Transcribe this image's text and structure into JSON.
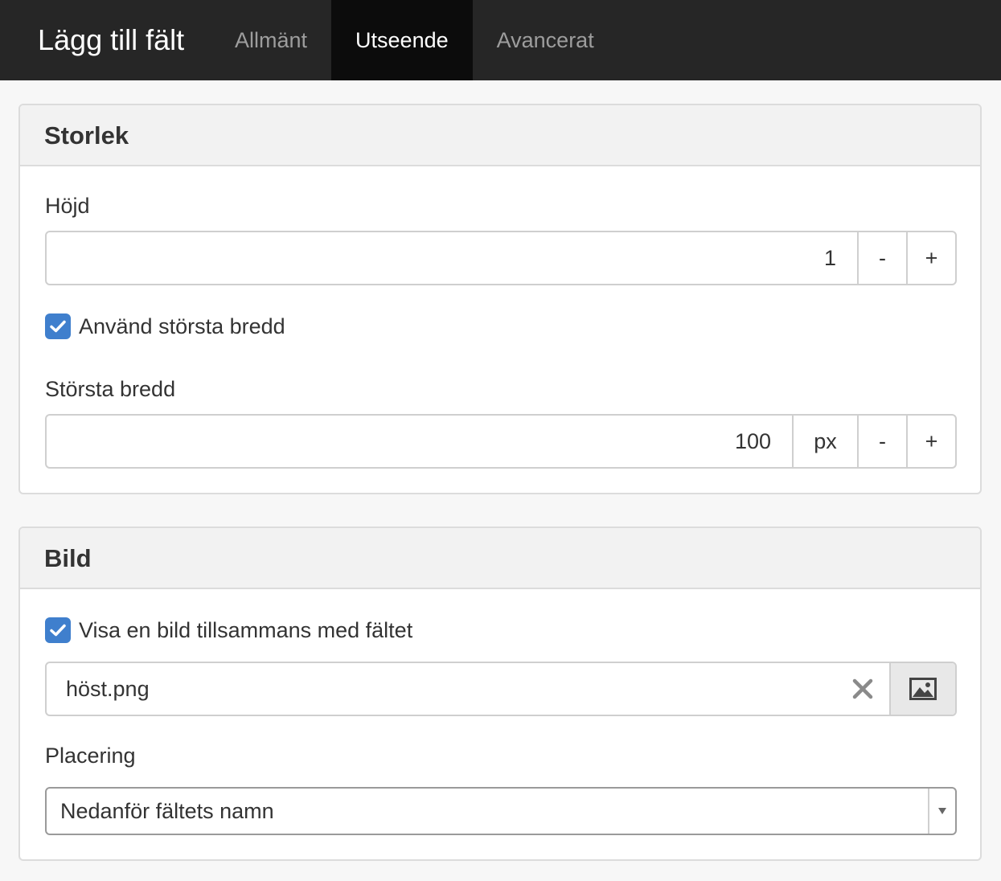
{
  "navbar": {
    "title": "Lägg till fält",
    "tabs": [
      {
        "label": "Allmänt",
        "active": false
      },
      {
        "label": "Utseende",
        "active": true
      },
      {
        "label": "Avancerat",
        "active": false
      }
    ]
  },
  "size_panel": {
    "heading": "Storlek",
    "height": {
      "label": "Höjd",
      "value": "1",
      "decrement": "-",
      "increment": "+"
    },
    "use_max_width": {
      "label": "Använd största bredd",
      "checked": true
    },
    "max_width": {
      "label": "Största bredd",
      "value": "100",
      "unit": "px",
      "decrement": "-",
      "increment": "+"
    }
  },
  "image_panel": {
    "heading": "Bild",
    "show_image": {
      "label": "Visa en bild tillsammans med fältet",
      "checked": true
    },
    "file": {
      "name": "höst.png",
      "clear_icon": "close-icon",
      "browse_icon": "image-icon"
    },
    "placement": {
      "label": "Placering",
      "selected": "Nedanför fältets namn"
    }
  },
  "colors": {
    "navbar_bg": "#262626",
    "active_tab_bg": "#0c0c0c",
    "checkbox_blue": "#3f7fcd"
  }
}
